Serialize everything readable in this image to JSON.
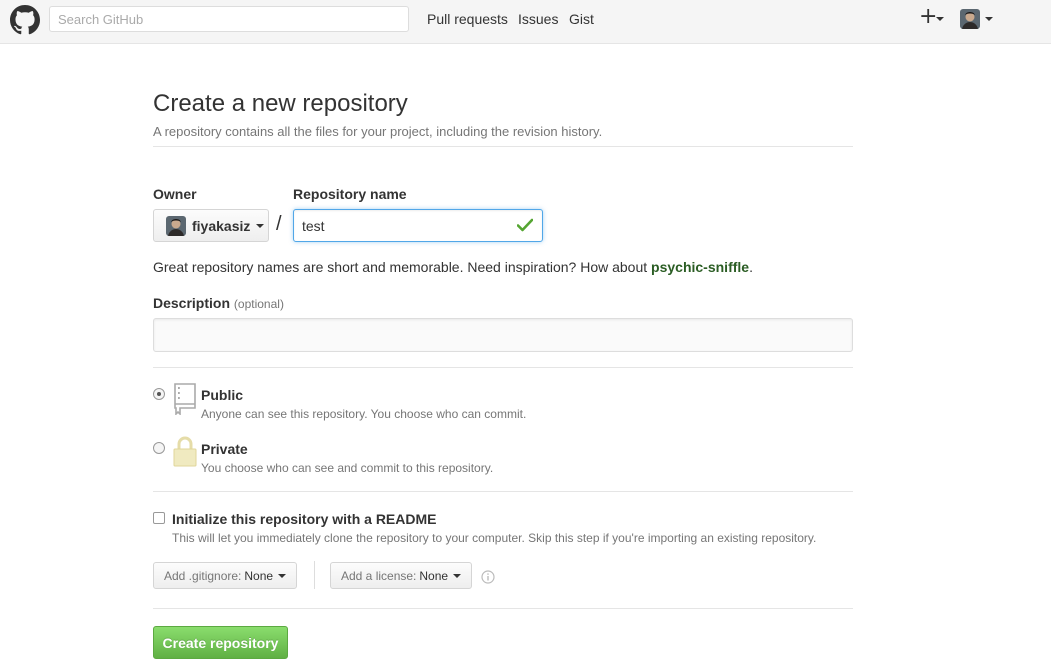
{
  "header": {
    "search_placeholder": "Search GitHub",
    "nav": [
      "Pull requests",
      "Issues",
      "Gist"
    ],
    "plus_symbol": "+"
  },
  "page": {
    "title": "Create a new repository",
    "subtitle": "A repository contains all the files for your project, including the revision history."
  },
  "form": {
    "owner_label": "Owner",
    "owner_value": "fiyakasiz",
    "separator": "/",
    "repo_name_label": "Repository name",
    "repo_name_value": "test",
    "hint_prefix": "Great repository names are short and memorable. Need inspiration? How about ",
    "hint_suggestion": "psychic-sniffle",
    "hint_suffix": ".",
    "description_label": "Description",
    "description_optional": "(optional)",
    "description_value": ""
  },
  "visibility": {
    "selected": "Public",
    "options": [
      {
        "title": "Public",
        "note": "Anyone can see this repository. You choose who can commit."
      },
      {
        "title": "Private",
        "note": "You choose who can see and commit to this repository."
      }
    ]
  },
  "init": {
    "readme_label": "Initialize this repository with a README",
    "readme_checked": false,
    "readme_note": "This will let you immediately clone the repository to your computer. Skip this step if you're importing an existing repository.",
    "gitignore_label": "Add .gitignore:",
    "gitignore_value": "None",
    "license_label": "Add a license:",
    "license_value": "None"
  },
  "actions": {
    "create_label": "Create repository"
  },
  "colors": {
    "primary_green": "#60b044",
    "focus_blue": "#51a7e8",
    "suggestion_green": "#2b5d24"
  }
}
